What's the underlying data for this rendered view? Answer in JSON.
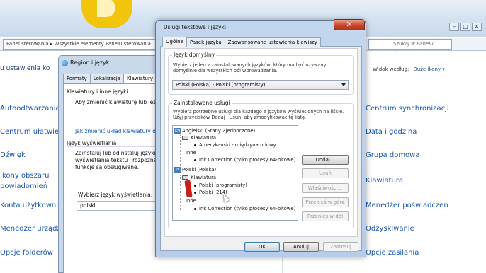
{
  "background_window": {
    "breadcrumb": "Panel sterowania ▸ Wszystkie elementy Panelu sterowania",
    "search_placeholder": "Szukaj w Panelu sterowania",
    "heading": "u ustawienia ko",
    "view_by_label": "Widok według:",
    "view_by_value": "Duże ikony ▾",
    "left_items": [
      {
        "label": "Autoodtwarzanie"
      },
      {
        "label": "Centrum ułatwie"
      },
      {
        "label": "Dźwięk"
      },
      {
        "label": "Ikony obszaru"
      },
      {
        "label": "powiadomień"
      },
      {
        "label": "Konta użytkowni"
      },
      {
        "label": "Menedżer urządz"
      },
      {
        "label": "Opcje folderów"
      }
    ],
    "right_items": [
      {
        "label": "Centrum synchronizacji"
      },
      {
        "label": "Data i godzina"
      },
      {
        "label": "Grupa domowa"
      },
      {
        "label": "Klawiatura"
      },
      {
        "label": "Menedżer poświadczeń"
      },
      {
        "label": "Odzyskiwanie"
      },
      {
        "label": "Opcje zasilania"
      }
    ]
  },
  "region_window": {
    "title": "Region i język",
    "tabs": [
      {
        "label": "Formaty"
      },
      {
        "label": "Lokalizacja"
      },
      {
        "label": "Klawiatury i ję"
      }
    ],
    "keyboards_heading": "Klawiatury i inne języki",
    "keyboards_desc": "Aby zmienić klawiaturę lub języ",
    "change_layout_link": "Jak zmienić układ klawiatury dla",
    "display_lang_heading": "Język wyświetlania",
    "display_lang_desc": [
      "Zainstaluj lub odinstaluj języki,",
      "wyświetlania tekstu i rozpoznaw",
      "funkcje są obsługiwane."
    ],
    "choose_label": "Wybierz język wyświetlania:",
    "choose_value": "polski"
  },
  "dialog": {
    "title": "Usługi tekstowe i języki",
    "close_glyph": "✕",
    "tabs": [
      {
        "label": "Ogólne",
        "selected": true
      },
      {
        "label": "Pasek języka",
        "selected": false
      },
      {
        "label": "Zaawansowane ustawienia klawiszy",
        "selected": false
      }
    ],
    "default_lang": {
      "heading": "Język domyślny",
      "desc": [
        "Wybierz jeden z zainstalowanych języków, który ma być używany",
        "domyślnie dla wszystkich pól wprowadzania."
      ],
      "value": "Polski (Polska) - Polski (programisty)"
    },
    "installed": {
      "heading": "Zainstalowane usługi",
      "desc": [
        "Wybierz potrzebne usługi dla każdego z języków wyświetlonych na liście.",
        "Użyj przycisków Dodaj i Usuń, aby zmodyfikować tę listę."
      ],
      "tree": [
        {
          "text": "Angielski (Stany Zjednoczone)",
          "badge": "EN"
        },
        {
          "text": "Klawiatura"
        },
        {
          "text": "Amerykański - międzynarodowy"
        },
        {
          "text": "Inne"
        },
        {
          "text": "Ink Correction (tylko procesy 64-bitowe)"
        },
        {
          "text": "Polski (Polska)",
          "badge": "PL"
        },
        {
          "text": "Klawiatura"
        },
        {
          "text": "Polski (programisty)"
        },
        {
          "text": "Polski (214)"
        },
        {
          "text": "Inne"
        },
        {
          "text": "Ink Correction (tylko procesy 64-bitowe)"
        }
      ],
      "buttons": {
        "add": "Dodaj...",
        "remove": "Usuń",
        "properties": "Właściwości...",
        "move_up": "Przenieś w górę",
        "move_down": "Przenieś w dół"
      }
    },
    "footer": {
      "ok": "OK",
      "cancel": "Anuluj",
      "apply": "Zastosuj"
    }
  }
}
